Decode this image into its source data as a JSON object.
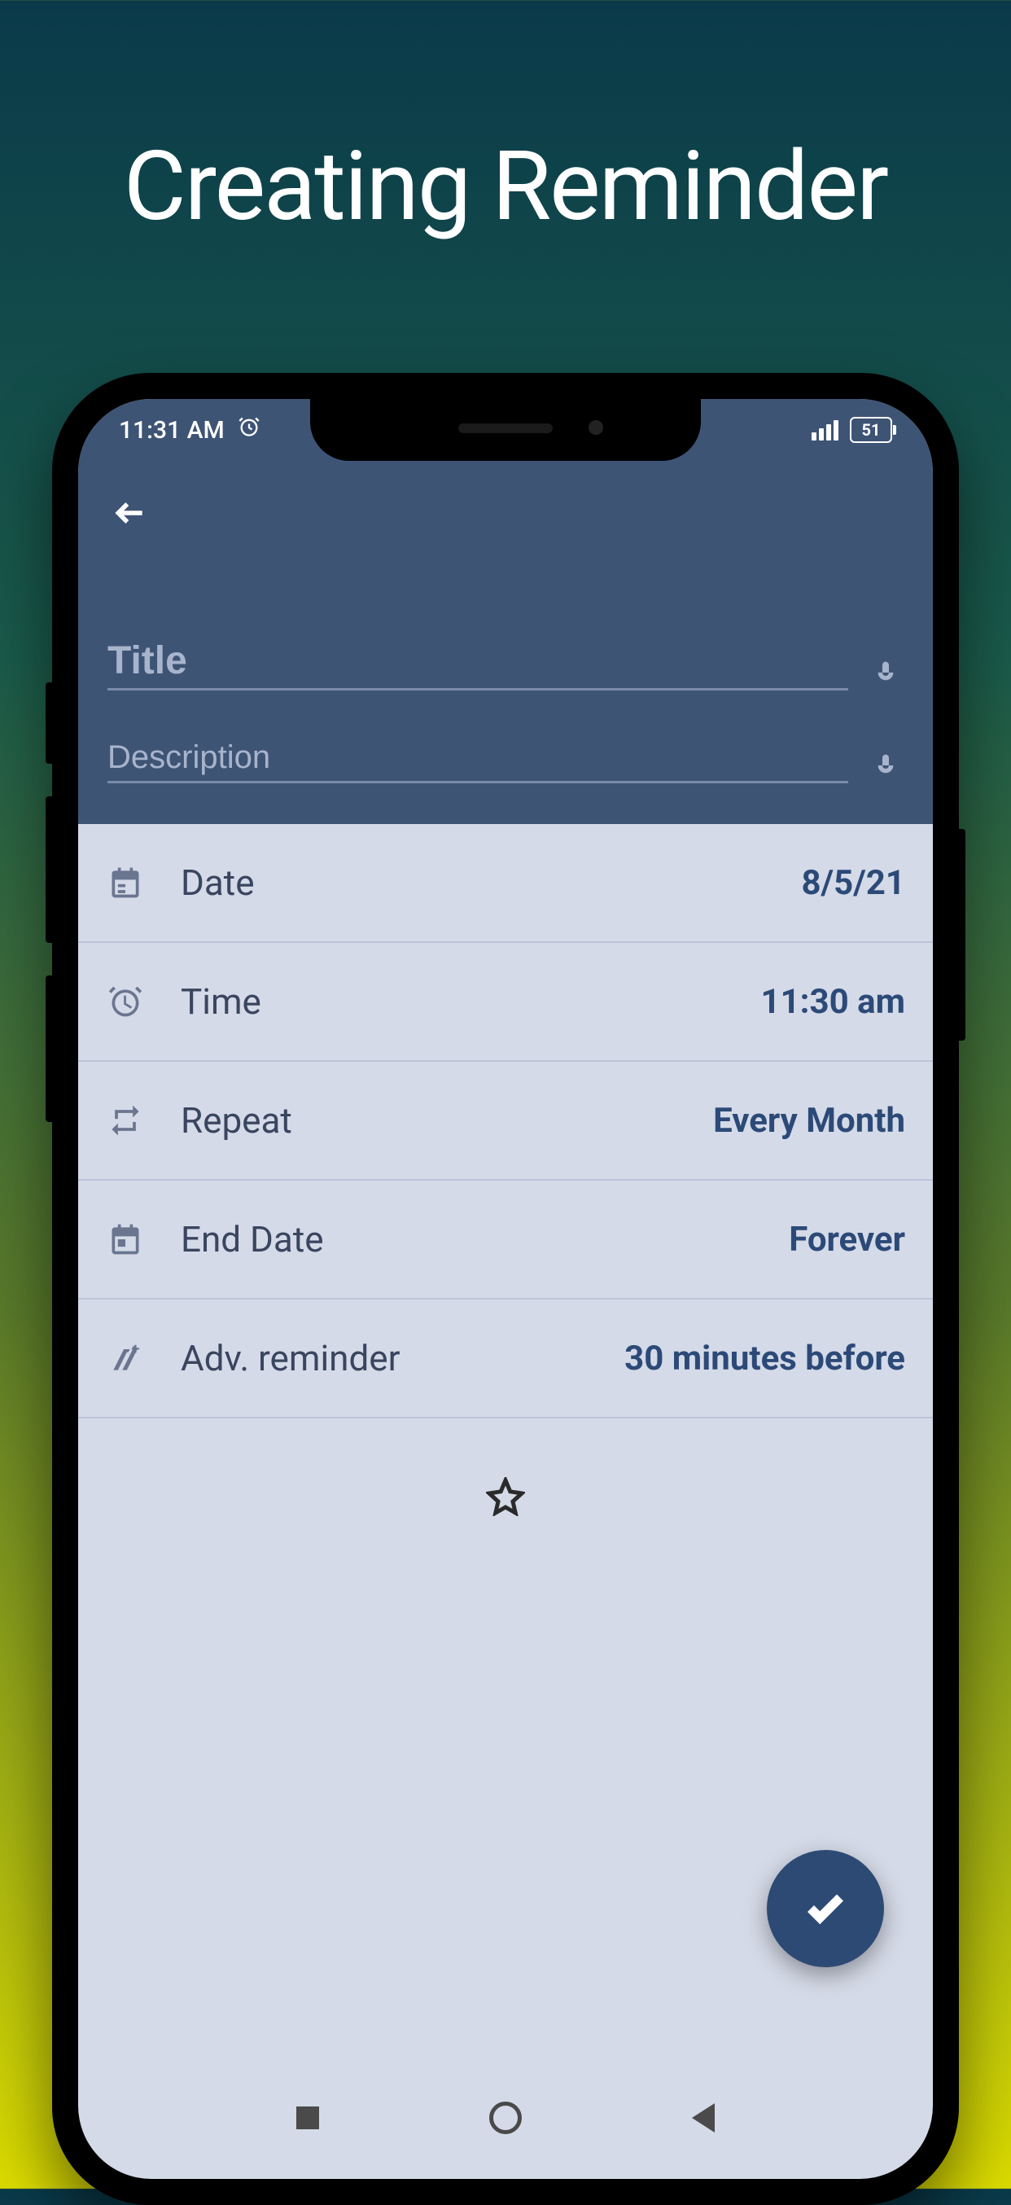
{
  "page": {
    "heading": "Creating Reminder"
  },
  "status_bar": {
    "time": "11:31 AM",
    "battery_level": "51"
  },
  "inputs": {
    "title_placeholder": "Title",
    "description_placeholder": "Description"
  },
  "rows": {
    "date": {
      "label": "Date",
      "value": "8/5/21"
    },
    "time": {
      "label": "Time",
      "value": "11:30 am"
    },
    "repeat": {
      "label": "Repeat",
      "value": "Every Month"
    },
    "end_date": {
      "label": "End Date",
      "value": "Forever"
    },
    "adv_reminder": {
      "label": "Adv. reminder",
      "value": "30 minutes before"
    }
  },
  "colors": {
    "header_bg": "#3e5475",
    "body_bg": "#d4dae7",
    "accent": "#2d4a74"
  }
}
